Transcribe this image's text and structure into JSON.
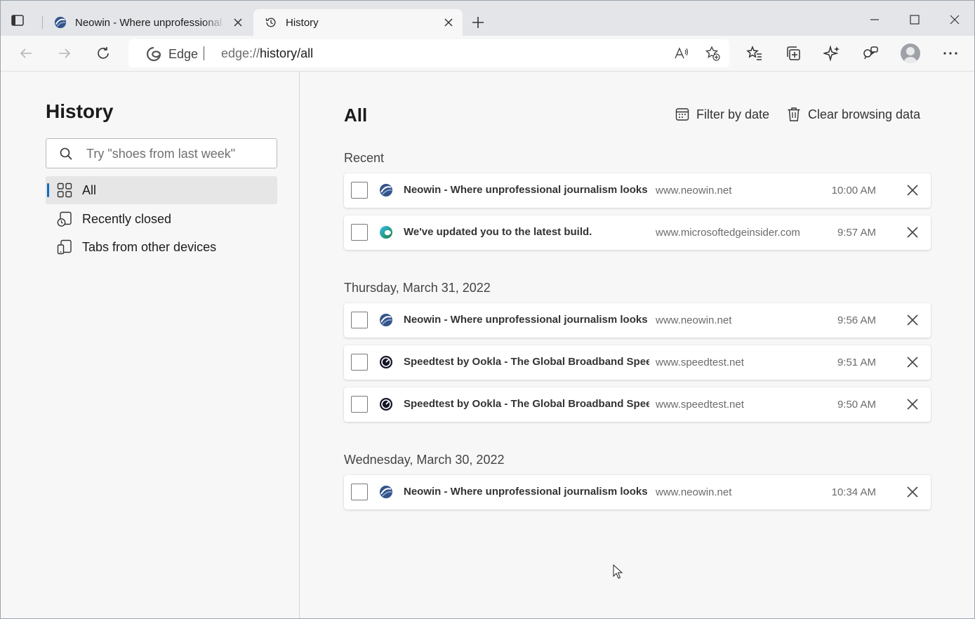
{
  "tabs": [
    {
      "title": "Neowin - Where unprofessional journalism looks better",
      "icon": "neowin-icon",
      "active": false
    },
    {
      "title": "History",
      "icon": "history-icon",
      "active": true
    }
  ],
  "toolbar": {
    "site_label": "Edge",
    "url_prefix": "edge://",
    "url_path": "history/all"
  },
  "sidebar": {
    "title": "History",
    "search_placeholder": "Try \"shoes from last week\"",
    "items": [
      {
        "label": "All",
        "selected": true,
        "icon": "grid-icon"
      },
      {
        "label": "Recently closed",
        "selected": false,
        "icon": "recently-closed-icon"
      },
      {
        "label": "Tabs from other devices",
        "selected": false,
        "icon": "devices-icon"
      }
    ]
  },
  "main": {
    "title": "All",
    "filter_label": "Filter by date",
    "clear_label": "Clear browsing data",
    "sections": [
      {
        "heading": "Recent",
        "entries": [
          {
            "title": "Neowin - Where unprofessional journalism looks ...",
            "domain": "www.neowin.net",
            "time": "10:00 AM",
            "icon": "neowin-icon"
          },
          {
            "title": "We've updated you to the latest build.",
            "domain": "www.microsoftedgeinsider.com",
            "time": "9:57 AM",
            "icon": "edge-icon"
          }
        ]
      },
      {
        "heading": "Thursday, March 31, 2022",
        "entries": [
          {
            "title": "Neowin - Where unprofessional journalism looks ...",
            "domain": "www.neowin.net",
            "time": "9:56 AM",
            "icon": "neowin-icon"
          },
          {
            "title": "Speedtest by Ookla - The Global Broadband Spee...",
            "domain": "www.speedtest.net",
            "time": "9:51 AM",
            "icon": "speedtest-icon"
          },
          {
            "title": "Speedtest by Ookla - The Global Broadband Spee...",
            "domain": "www.speedtest.net",
            "time": "9:50 AM",
            "icon": "speedtest-icon"
          }
        ]
      },
      {
        "heading": "Wednesday, March 30, 2022",
        "entries": [
          {
            "title": "Neowin - Where unprofessional journalism looks ...",
            "domain": "www.neowin.net",
            "time": "10:34 AM",
            "icon": "neowin-icon"
          }
        ]
      }
    ]
  },
  "colors": {
    "accent": "#0f6cbd",
    "tabstrip": "#e3e5e8",
    "page_bg": "#f7f7f7"
  }
}
